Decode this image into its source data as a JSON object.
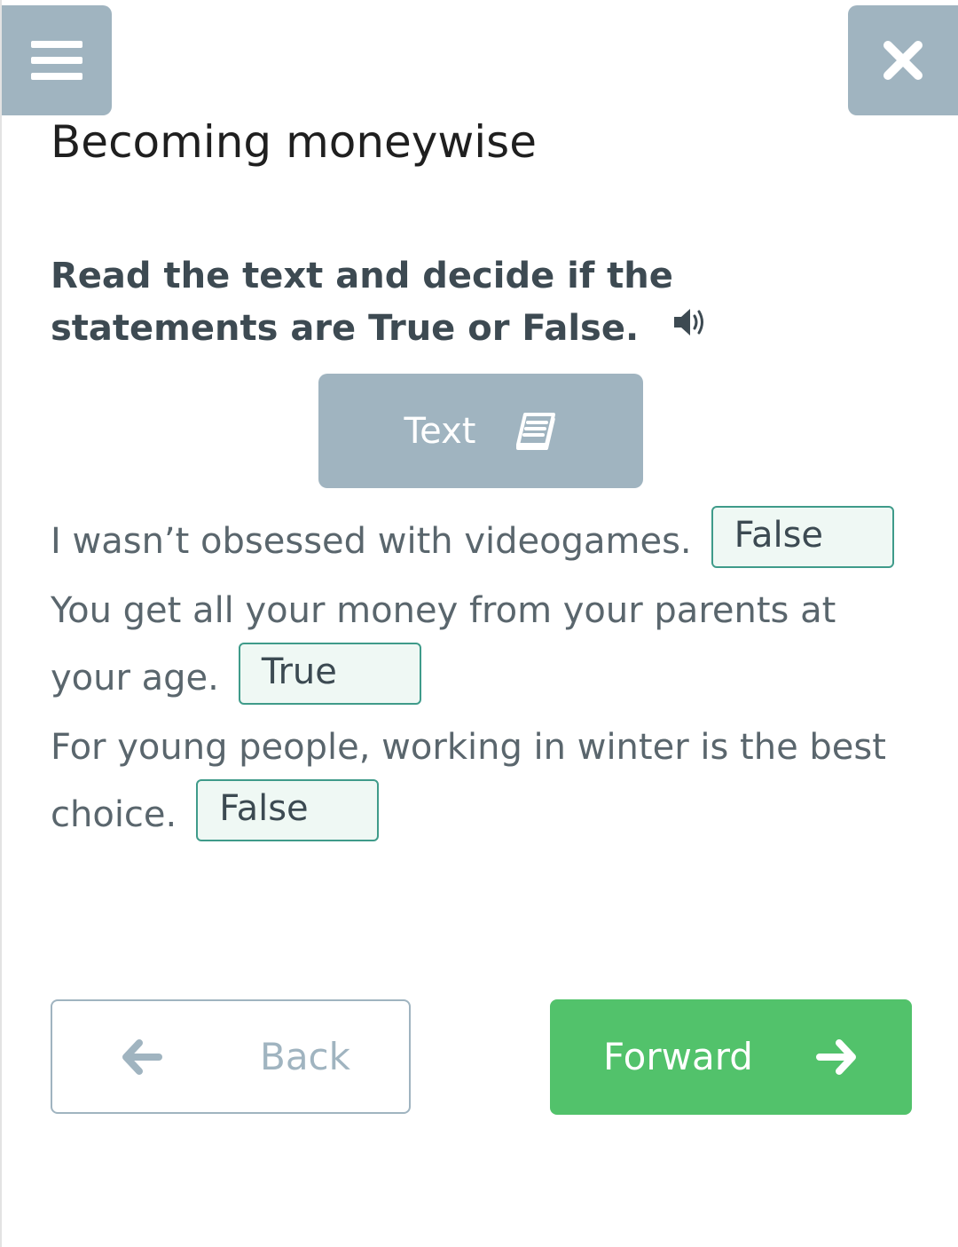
{
  "header": {
    "menu_icon": "hamburger-menu-icon",
    "close_icon": "close-x-icon",
    "title": "Becoming moneywise"
  },
  "task": {
    "instructions": "Read the text and decide if the statements are True or False.",
    "audio_icon": "speaker-icon"
  },
  "text_button": {
    "label": "Text",
    "icon": "book-icon"
  },
  "statements": [
    {
      "text": "I wasn’t obsessed with videogames.",
      "answer": "False"
    },
    {
      "text": "You get all your money from your parents at your age.",
      "answer": "True"
    },
    {
      "text": "For young people, working in winter is the best choice.",
      "answer": "False"
    }
  ],
  "navigation": {
    "back_label": "Back",
    "back_icon": "arrow-left-icon",
    "forward_label": "Forward",
    "forward_icon": "arrow-right-icon"
  },
  "colors": {
    "header_button": "#a0b4c0",
    "answer_border": "#3f9b8a",
    "answer_bg": "#eff8f4",
    "forward_bg": "#52c26b"
  }
}
